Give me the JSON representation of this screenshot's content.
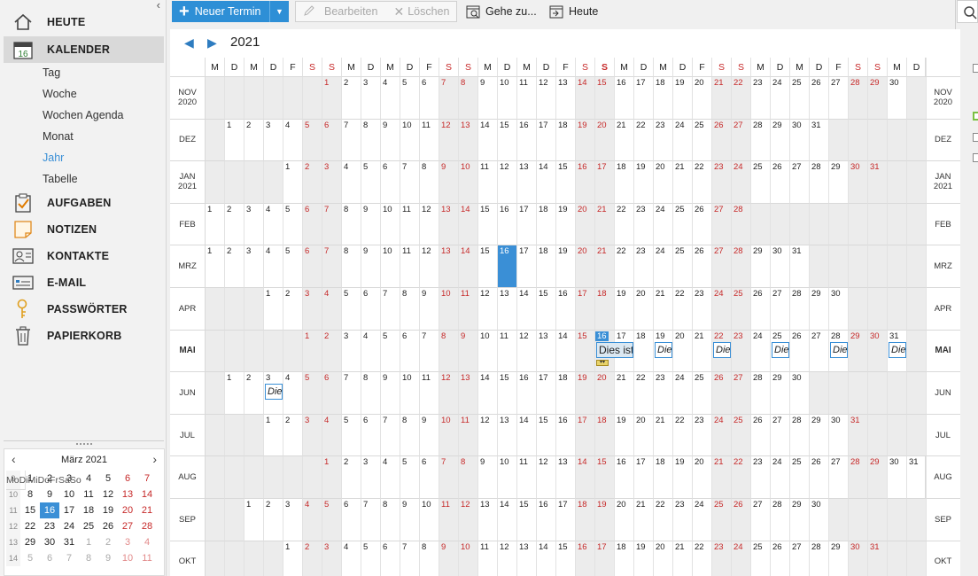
{
  "sidebar": {
    "nav": [
      {
        "key": "heute",
        "label": "HEUTE",
        "icon": "home-icon"
      },
      {
        "key": "kalender",
        "label": "KALENDER",
        "icon": "calendar-icon",
        "badge": "16"
      },
      {
        "key": "aufgaben",
        "label": "AUFGABEN",
        "icon": "clipboard-check-icon"
      },
      {
        "key": "notizen",
        "label": "NOTIZEN",
        "icon": "note-icon"
      },
      {
        "key": "kontakte",
        "label": "KONTAKTE",
        "icon": "contact-card-icon"
      },
      {
        "key": "email",
        "label": "E-MAIL",
        "icon": "email-icon"
      },
      {
        "key": "passwoerter",
        "label": "PASSWÖRTER",
        "icon": "key-icon"
      },
      {
        "key": "papierkorb",
        "label": "PAPIERKORB",
        "icon": "trash-icon"
      }
    ],
    "views": [
      "Tag",
      "Woche",
      "Wochen Agenda",
      "Monat",
      "Jahr",
      "Tabelle"
    ],
    "selected_view": "Jahr",
    "mini_calendar": {
      "title": "März  2021",
      "day_headers": [
        "Mo",
        "Di",
        "Mi",
        "Do",
        "Fr",
        "Sa",
        "So"
      ],
      "weeks": [
        {
          "wk": "9",
          "days": [
            "1",
            "2",
            "3",
            "4",
            "5",
            "6",
            "7"
          ]
        },
        {
          "wk": "10",
          "days": [
            "8",
            "9",
            "10",
            "11",
            "12",
            "13",
            "14"
          ]
        },
        {
          "wk": "11",
          "days": [
            "15",
            "16",
            "17",
            "18",
            "19",
            "20",
            "21"
          ]
        },
        {
          "wk": "12",
          "days": [
            "22",
            "23",
            "24",
            "25",
            "26",
            "27",
            "28"
          ]
        },
        {
          "wk": "13",
          "days": [
            "29",
            "30",
            "31",
            "1",
            "2",
            "3",
            "4"
          ]
        },
        {
          "wk": "14",
          "days": [
            "5",
            "6",
            "7",
            "8",
            "9",
            "10",
            "11"
          ]
        }
      ],
      "today": "16"
    }
  },
  "toolbar": {
    "new_label": "Neuer Termin",
    "edit_label": "Bearbeiten",
    "delete_label": "Löschen",
    "goto_label": "Gehe zu...",
    "today_label": "Heute"
  },
  "calendar": {
    "year": "2021",
    "day_headers": [
      "M",
      "D",
      "M",
      "D",
      "F",
      "S",
      "S",
      "M",
      "D",
      "M",
      "D",
      "F",
      "S",
      "S",
      "M",
      "D",
      "M",
      "D",
      "F",
      "S",
      "S",
      "M",
      "D",
      "M",
      "D",
      "F",
      "S",
      "S",
      "M",
      "D",
      "M",
      "D",
      "F",
      "S",
      "S",
      "M",
      "D"
    ],
    "today_header_index": 20,
    "months": [
      {
        "label": [
          "NOV",
          "2020"
        ],
        "start": 6,
        "days": 30
      },
      {
        "label": [
          "DEZ"
        ],
        "start": 1,
        "days": 31
      },
      {
        "label": [
          "JAN",
          "2021"
        ],
        "start": 4,
        "days": 31
      },
      {
        "label": [
          "FEB"
        ],
        "start": 0,
        "days": 28
      },
      {
        "label": [
          "MRZ"
        ],
        "start": 0,
        "days": 31,
        "selected_day": 16
      },
      {
        "label": [
          "APR"
        ],
        "start": 3,
        "days": 30
      },
      {
        "label": [
          "MAI"
        ],
        "start": 5,
        "days": 31,
        "bold": true,
        "today": 16
      },
      {
        "label": [
          "JUN"
        ],
        "start": 1,
        "days": 30
      },
      {
        "label": [
          "JUL"
        ],
        "start": 3,
        "days": 31
      },
      {
        "label": [
          "AUG"
        ],
        "start": 6,
        "days": 31
      },
      {
        "label": [
          "SEP"
        ],
        "start": 2,
        "days": 30
      },
      {
        "label": [
          "OKT"
        ],
        "start": 4,
        "days": 31
      }
    ],
    "appointment_text": "Dies ist",
    "appointment_text_short": "Die"
  }
}
